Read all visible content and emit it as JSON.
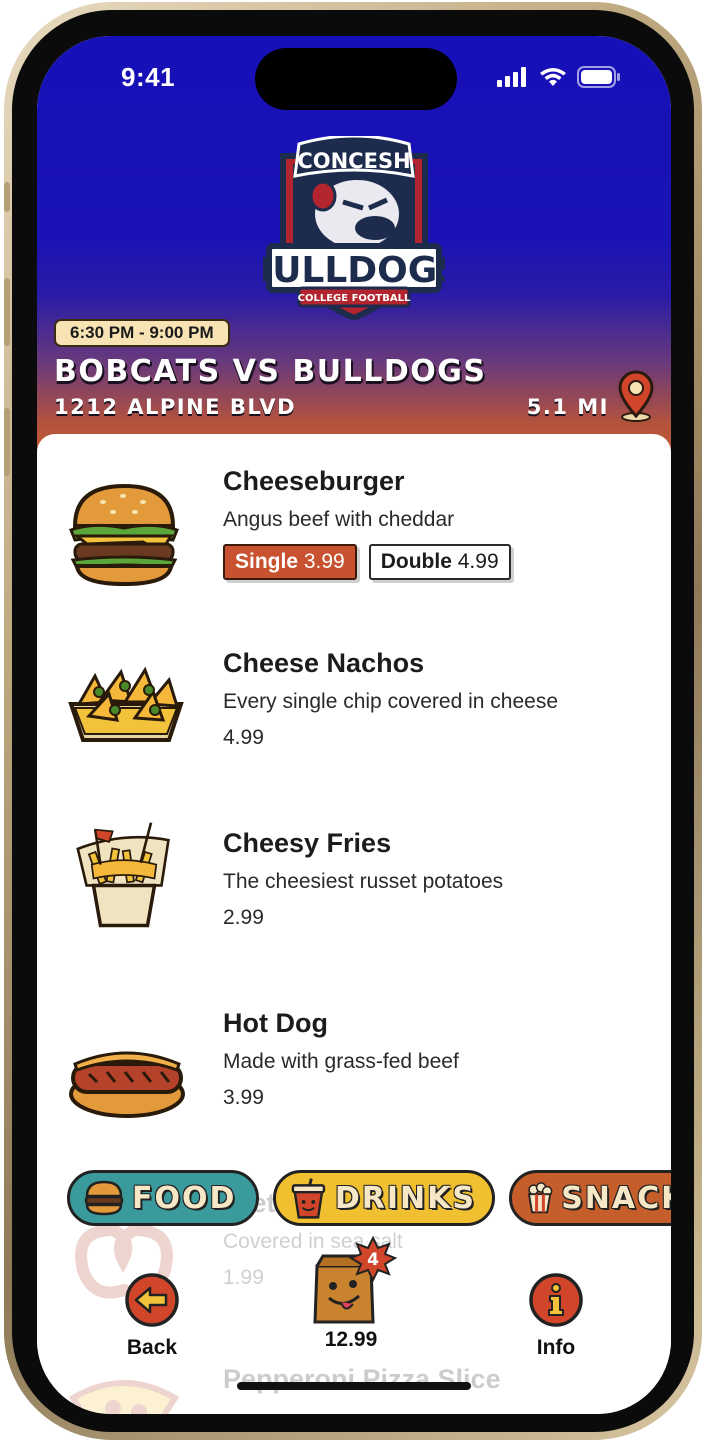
{
  "status_bar": {
    "time": "9:41"
  },
  "header": {
    "logo": {
      "line1": "CONCESH",
      "line2": "BULLDOGS",
      "line3": "COLLEGE FOOTBALL"
    },
    "time_range": "6:30 PM - 9:00 PM",
    "game_title": "BOBCATS VS BULLDOGS",
    "address": "1212 ALPINE BLVD",
    "distance": "5.1 MI",
    "location_icon": "map-pin-icon"
  },
  "menu_items": [
    {
      "name": "Cheeseburger",
      "description": "Angus beef with cheddar",
      "icon": "cheeseburger-icon",
      "sizes": [
        {
          "label": "Single",
          "price": "3.99",
          "selected": true
        },
        {
          "label": "Double",
          "price": "4.99",
          "selected": false
        }
      ]
    },
    {
      "name": "Cheese Nachos",
      "description": "Every single chip covered in cheese",
      "price": "4.99",
      "icon": "nachos-icon"
    },
    {
      "name": "Cheesy Fries",
      "description": "The cheesiest russet potatoes",
      "price": "2.99",
      "icon": "fries-icon"
    },
    {
      "name": "Hot Dog",
      "description": "Made with grass-fed beef",
      "price": "3.99",
      "icon": "hot-dog-icon"
    },
    {
      "name": "Pretzel",
      "description": "Covered in sea salt",
      "price": "1.99",
      "icon": "pretzel-icon"
    },
    {
      "name": "Pepperoni Pizza Slice",
      "description": "",
      "price": "",
      "icon": "pizza-icon"
    }
  ],
  "categories": [
    {
      "label": "FOOD",
      "icon": "burger-icon",
      "color": "#3a9a9c",
      "active": true
    },
    {
      "label": "DRINKS",
      "icon": "cup-icon",
      "color": "#f0c030",
      "active": false
    },
    {
      "label": "SNACKS",
      "icon": "popcorn-icon",
      "color": "#c55e2a",
      "active": false
    }
  ],
  "bottom_nav": {
    "back_label": "Back",
    "cart_total": "12.99",
    "cart_count": "4",
    "info_label": "Info"
  },
  "colors": {
    "header_top": "#1610b8",
    "header_bottom": "#c45a35",
    "accent": "#c8522f"
  }
}
